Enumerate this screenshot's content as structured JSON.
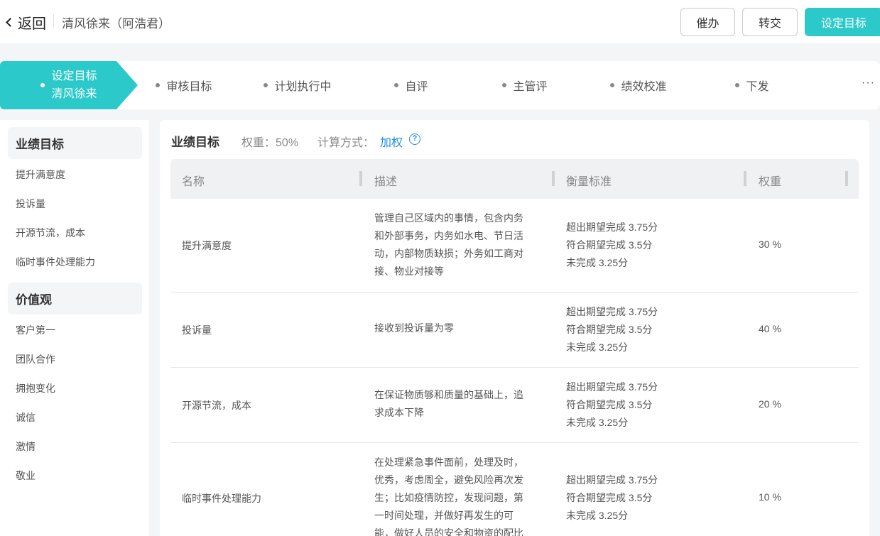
{
  "header": {
    "back_label": "返回",
    "title": "清风徐来（阿浩君）",
    "buttons": [
      "催办",
      "转交",
      "设定目标"
    ]
  },
  "steps": [
    {
      "line1": "设定目标",
      "line2": "清风徐来"
    },
    {
      "label": "审核目标"
    },
    {
      "label": "计划执行中"
    },
    {
      "label": "自评"
    },
    {
      "label": "主管评"
    },
    {
      "label": "绩效校准"
    },
    {
      "label": "下发"
    }
  ],
  "steps_more": "···",
  "sidebar": {
    "groups": [
      {
        "title": "业绩目标",
        "items": [
          "提升满意度",
          "投诉量",
          "开源节流，成本",
          "临时事件处理能力"
        ]
      },
      {
        "title": "价值观",
        "items": [
          "客户第一",
          "团队合作",
          "拥抱变化",
          "诚信",
          "激情",
          "敬业"
        ]
      }
    ]
  },
  "section": {
    "title": "业绩目标",
    "weight_label": "权重：",
    "weight_value": "50%",
    "calc_label": "计算方式：",
    "calc_value": "加权",
    "help_glyph": "?"
  },
  "table": {
    "headers": [
      "名称",
      "描述",
      "衡量标准",
      "权重"
    ],
    "rows": [
      {
        "name": "提升满意度",
        "desc": [
          "管理自己区域内的事情，包含内务",
          "和外部事务，内务如水电、节日活",
          "动，内部物质缺损；外务如工商对",
          "接、物业对接等"
        ],
        "standard": [
          "超出期望完成 3.75分",
          "符合期望完成 3.5分",
          "未完成 3.25分"
        ],
        "weight": "30 %"
      },
      {
        "name": "投诉量",
        "desc": [
          "接收到投诉量为零"
        ],
        "standard": [
          "超出期望完成 3.75分",
          "符合期望完成 3.5分",
          "未完成 3.25分"
        ],
        "weight": "40 %"
      },
      {
        "name": "开源节流，成本",
        "desc": [
          "在保证物质够和质量的基础上，追",
          "求成本下降"
        ],
        "standard": [
          "超出期望完成 3.75分",
          "符合期望完成 3.5分",
          "未完成 3.25分"
        ],
        "weight": "20 %"
      },
      {
        "name": "临时事件处理能力",
        "desc": [
          "在处理紧急事件面前，处理及时，",
          "优秀，考虑周全，避免风险再次发",
          "生；比如疫情防控，发现问题，第",
          "一时间处理，并做好再发生的可",
          "能，做好人员的安全和物资的配比"
        ],
        "standard": [
          "超出期望完成 3.75分",
          "符合期望完成 3.5分",
          "未完成 3.25分"
        ],
        "weight": "10 %"
      }
    ]
  },
  "colors": {
    "accent": "#2bc9c9",
    "link": "#1f8ee6"
  }
}
